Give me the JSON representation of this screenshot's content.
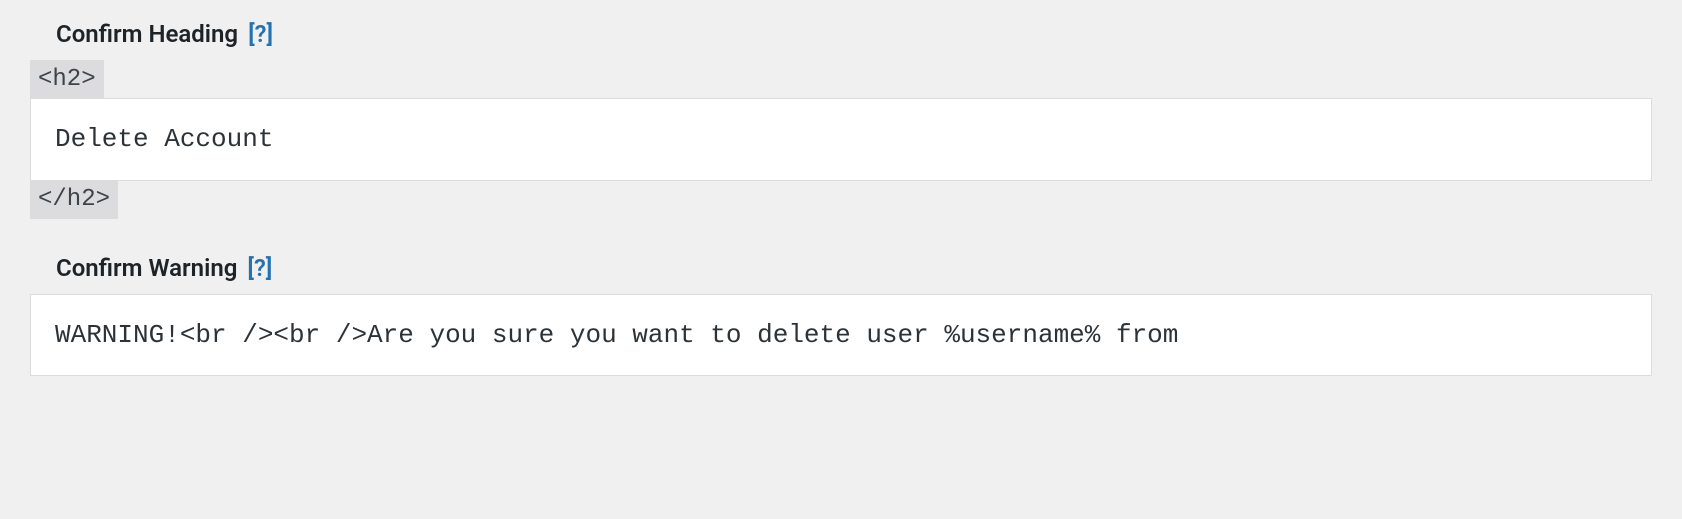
{
  "fields": {
    "confirm_heading": {
      "label": "Confirm Heading",
      "help": "[?]",
      "open_tag": "<h2>",
      "close_tag": "</h2>",
      "value": "Delete Account"
    },
    "confirm_warning": {
      "label": "Confirm Warning",
      "help": "[?]",
      "value": "WARNING!<br /><br />Are you sure you want to delete user %username% from"
    }
  }
}
